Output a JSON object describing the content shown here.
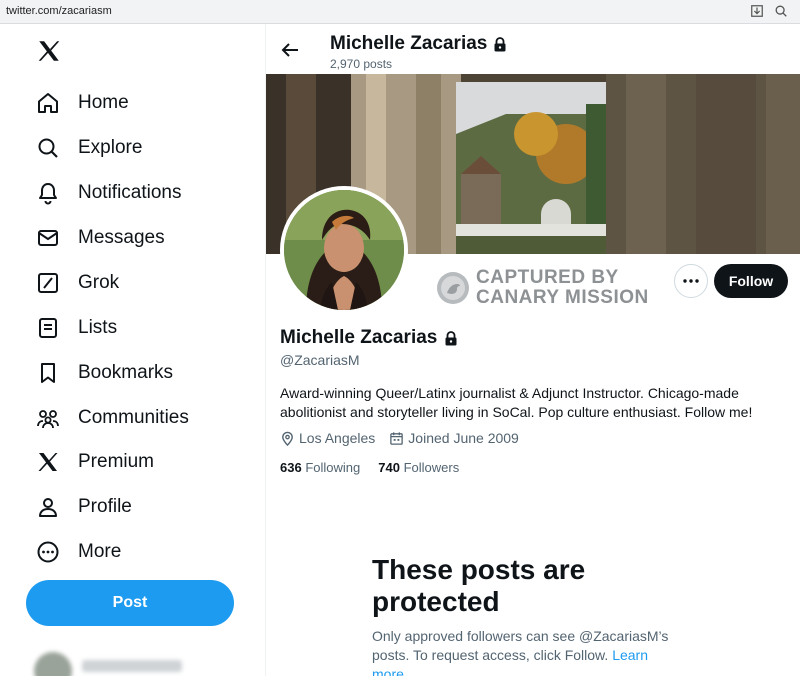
{
  "browser": {
    "url": "twitter.com/zacariasm"
  },
  "sidebar": {
    "items": [
      {
        "label": "Home",
        "icon": "home-icon"
      },
      {
        "label": "Explore",
        "icon": "search-icon"
      },
      {
        "label": "Notifications",
        "icon": "bell-icon"
      },
      {
        "label": "Messages",
        "icon": "envelope-icon"
      },
      {
        "label": "Grok",
        "icon": "grok-icon"
      },
      {
        "label": "Lists",
        "icon": "list-icon"
      },
      {
        "label": "Bookmarks",
        "icon": "bookmark-icon"
      },
      {
        "label": "Communities",
        "icon": "people-icon"
      },
      {
        "label": "Premium",
        "icon": "x-icon"
      },
      {
        "label": "Profile",
        "icon": "person-icon"
      },
      {
        "label": "More",
        "icon": "more-circle-icon"
      }
    ],
    "post_label": "Post"
  },
  "header": {
    "name": "Michelle Zacarias",
    "post_count": "2,970 posts"
  },
  "watermark": {
    "line1": "CAPTURED BY",
    "line2": "CANARY MISSION"
  },
  "profile": {
    "name": "Michelle Zacarias",
    "handle": "@ZacariasM",
    "bio": "Award-winning Queer/Latinx journalist & Adjunct Instructor. Chicago-made abolitionist and storyteller living in SoCal. Pop culture enthusiast. Follow me!",
    "location": "Los Angeles",
    "joined": "Joined June 2009",
    "following_count": "636",
    "following_label": "Following",
    "followers_count": "740",
    "followers_label": "Followers",
    "follow_label": "Follow"
  },
  "protected": {
    "title": "These posts are protected",
    "body": "Only approved followers can see @ZacariasM’s posts. To request access, click Follow.",
    "link": "Learn more"
  },
  "colors": {
    "accent": "#1d9bf0",
    "text": "#0f1419",
    "muted": "#536471"
  }
}
